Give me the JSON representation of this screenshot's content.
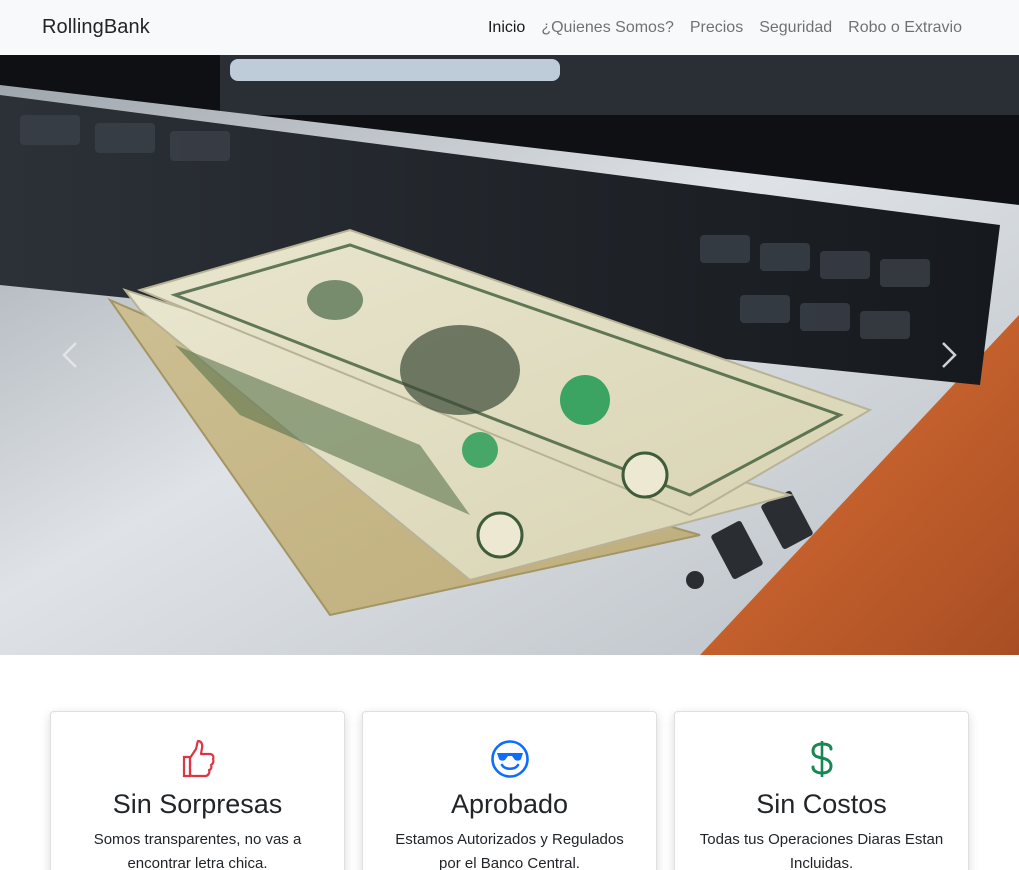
{
  "navbar": {
    "brand": "RollingBank",
    "links": [
      {
        "label": "Inicio",
        "active": true
      },
      {
        "label": "¿Quienes Somos?",
        "active": false
      },
      {
        "label": "Precios",
        "active": false
      },
      {
        "label": "Seguridad",
        "active": false
      },
      {
        "label": "Robo o Extravio",
        "active": false
      }
    ]
  },
  "carousel": {
    "image": "dollar-bills-on-laptop",
    "prev_icon": "chevron-left-icon",
    "next_icon": "chevron-right-icon"
  },
  "cards": [
    {
      "icon": "thumbs-up-icon",
      "icon_color": "#dc3545",
      "title": "Sin Sorpresas",
      "text": "Somos transparentes, no vas a encontrar letra chica."
    },
    {
      "icon": "smile-sunglasses-icon",
      "icon_color": "#0d6efd",
      "title": "Aprobado",
      "text": "Estamos Autorizados y Regulados por el Banco Central."
    },
    {
      "icon": "dollar-sign-icon",
      "icon_color": "#198754",
      "title": "Sin Costos",
      "text": "Todas tus Operaciones Diaras Estan Incluidas."
    }
  ]
}
